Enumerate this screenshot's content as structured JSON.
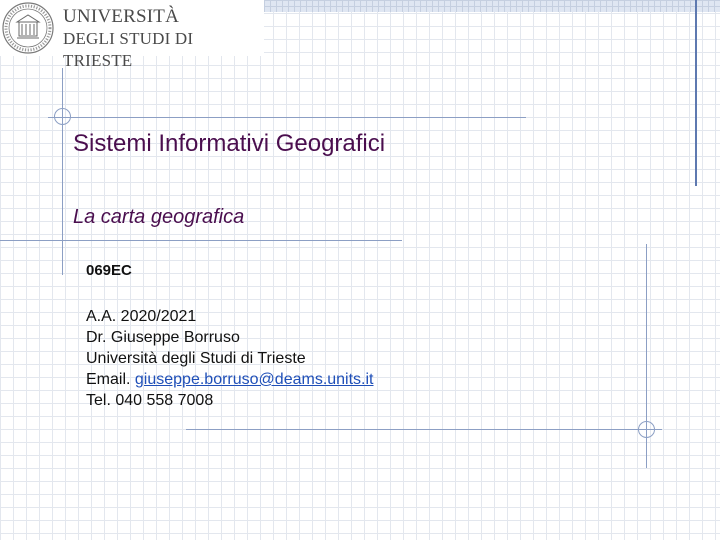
{
  "logo": {
    "line1": "UNIVERSITÀ",
    "line2": "DEGLI STUDI DI TRIESTE"
  },
  "slide": {
    "title": "Sistemi Informativi Geografici",
    "subtitle": "La carta geografica",
    "course_code": "069EC",
    "academic_year": "A.A. 2020/2021",
    "lecturer": "Dr. Giuseppe Borruso",
    "university": "Università degli Studi di Trieste",
    "email_prefix": "Email. ",
    "email": "giuseppe.borruso@deams.units.it",
    "phone": "Tel. 040 558 7008"
  },
  "colors": {
    "title": "#4a0e4e",
    "accent_lines": "#8c9fc4",
    "link": "#1f4fb8"
  }
}
